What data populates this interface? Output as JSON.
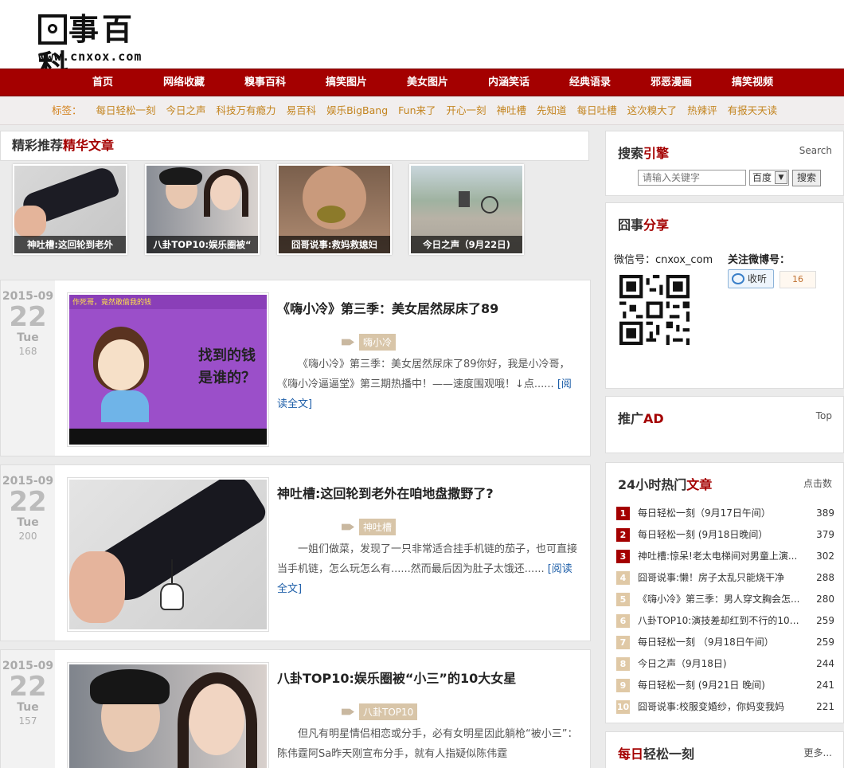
{
  "header": {
    "logo_text": "事百科",
    "logo_url": "www.cnxox.com"
  },
  "nav": [
    "首页",
    "网络收藏",
    "糗事百科",
    "搞笑图片",
    "美女图片",
    "内涵笑话",
    "经典语录",
    "邪恶漫画",
    "搞笑视频"
  ],
  "tags": {
    "label": "标签：",
    "items": [
      "每日轻松一刻",
      "今日之声",
      "科技万有瘾力",
      "易百科",
      "娱乐BigBang",
      "Fun来了",
      "开心一刻",
      "神吐槽",
      "先知道",
      "每日吐槽",
      "这次糗大了",
      "热辣评",
      "有报天天读"
    ]
  },
  "featured": {
    "title_plain": "精彩推荐",
    "title_hl": "精华文章",
    "items": [
      {
        "caption": "神吐槽:这回轮到老外"
      },
      {
        "caption": "八卦TOP10:娱乐圈被“"
      },
      {
        "caption": "囧哥说事:救妈救媳妇"
      },
      {
        "caption": "今日之声（9月22日)"
      }
    ]
  },
  "articles": [
    {
      "ym": "2015-09",
      "day": "22",
      "weekday": "Tue",
      "views": "168",
      "title": "《嗨小冷》第三季：美女居然尿床了89",
      "tag": "嗨小冷",
      "excerpt": "《嗨小冷》第三季：美女居然尿床了89你好，我是小冷哥，《嗨小冷逼逼堂》第三期热播中！——速度围观哦！↓点......",
      "more": "[阅读全文]",
      "img_text1": "找到的钱",
      "img_text2": "是谁的？",
      "img_banner": "作死哥，竟然敢偷我的钱"
    },
    {
      "ym": "2015-09",
      "day": "22",
      "weekday": "Tue",
      "views": "200",
      "title": "神吐槽:这回轮到老外在咱地盘撒野了?",
      "tag": "神吐槽",
      "excerpt": "一姐们做菜，发现了一只非常适合挂手机链的茄子，也可直接当手机链，怎么玩怎么有......然而最后因为肚子太饿还......",
      "more": "[阅读全文]"
    },
    {
      "ym": "2015-09",
      "day": "22",
      "weekday": "Tue",
      "views": "157",
      "title": "八卦TOP10:娱乐圈被“小三”的10大女星",
      "tag": "八卦TOP10",
      "excerpt": "但凡有明星情侣相恋或分手，必有女明星因此躺枪“被小三”：陈伟霆阿Sa昨天刚宣布分手，就有人指疑似陈伟霆",
      "more": ""
    }
  ],
  "sidebar": {
    "search": {
      "title_plain": "搜索",
      "title_hl": "引擎",
      "right": "Search",
      "placeholder": "请输入关键字",
      "engine": "百度",
      "button": "搜索"
    },
    "share": {
      "title_plain": "囧事",
      "title_hl": "分享",
      "wechat": "微信号：cnxox_com",
      "weibo": "关注微博号：",
      "follow": "收听",
      "count": "16"
    },
    "ad": {
      "title_plain": "推广",
      "title_hl": "AD",
      "right": "Top"
    },
    "hot": {
      "title_plain": "24小时热门",
      "title_hl": "文章",
      "right": "点击数",
      "items": [
        {
          "n": "1",
          "t": "每日轻松一刻（9月17日午间）",
          "c": "389"
        },
        {
          "n": "2",
          "t": "每日轻松一刻 (9月18日晚间）",
          "c": "379"
        },
        {
          "n": "3",
          "t": "神吐槽:惊呆!老太电梯间对男童上演...",
          "c": "302"
        },
        {
          "n": "4",
          "t": "囧哥说事:懒！房子太乱只能烧干净",
          "c": "288"
        },
        {
          "n": "5",
          "t": "《嗨小冷》第三季：男人穿文胸会怎...",
          "c": "280"
        },
        {
          "n": "6",
          "t": "八卦TOP10:演技差却红到不行的10大...",
          "c": "259"
        },
        {
          "n": "7",
          "t": "每日轻松一刻 （9月18日午间）",
          "c": "259"
        },
        {
          "n": "8",
          "t": "今日之声（9月18日)",
          "c": "244"
        },
        {
          "n": "9",
          "t": "每日轻松一刻 (9月21日 晚间)",
          "c": "241"
        },
        {
          "n": "10",
          "t": "囧哥说事:校服变婚纱，你妈变我妈",
          "c": "221"
        }
      ]
    },
    "daily": {
      "title_plain": "轻松一刻",
      "title_hl": "每日",
      "right": "更多..."
    }
  },
  "colors": {
    "brand": "#a40000",
    "tag_orange": "#c3841e",
    "link_blue": "#1d5ea8"
  }
}
